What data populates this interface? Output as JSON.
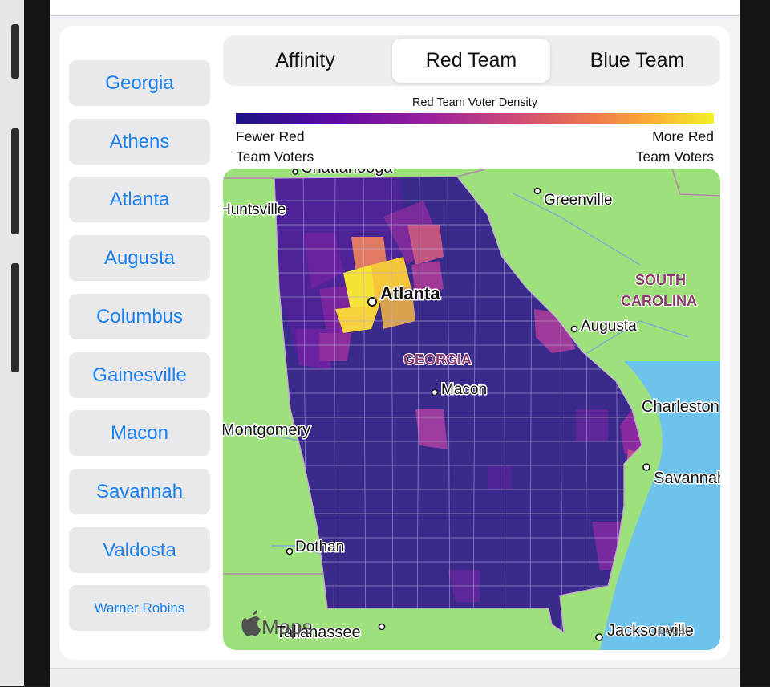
{
  "title": "",
  "segments": [
    {
      "label": "Affinity",
      "selected": false
    },
    {
      "label": "Red Team",
      "selected": true
    },
    {
      "label": "Blue Team",
      "selected": false
    }
  ],
  "cities": [
    "Georgia",
    "Athens",
    "Atlanta",
    "Augusta",
    "Columbus",
    "Gainesville",
    "Macon",
    "Savannah",
    "Valdosta",
    "Warner Robins"
  ],
  "legend": {
    "title": "Red Team Voter Density",
    "low_line1": "Fewer Red",
    "low_line2": "Team Voters",
    "high_line1": "More Red",
    "high_line2": "Team Voters",
    "gradient_colors": [
      "#1e1386",
      "#5a0aa4",
      "#9a1f9e",
      "#cd4a78",
      "#ef7a4c",
      "#fcb232",
      "#f1f228"
    ]
  },
  "map": {
    "state_name": "GEORGIA",
    "neighbor_state": {
      "line1": "SOUTH",
      "line2": "CAROLINA"
    },
    "cities": {
      "chattanooga": "Chattanooga",
      "huntsville": "Huntsville",
      "greenville": "Greenville",
      "atlanta": "Atlanta",
      "augusta": "Augusta",
      "macon": "Macon",
      "charleston": "Charleston",
      "montgomery": "Montgomery",
      "savannah": "Savannah",
      "dothan": "Dothan",
      "tallahassee": "Tallahassee",
      "jacksonville": "Jacksonville"
    },
    "attribution": "Maps",
    "legal": "Legal",
    "colors": {
      "land": "#9ee07c",
      "water": "#6ec3ec",
      "base_county": "#3a2a8c",
      "mid_county": "#6a22a0",
      "hot_county": "#d06a78",
      "peak_county": "#f4e234"
    }
  }
}
